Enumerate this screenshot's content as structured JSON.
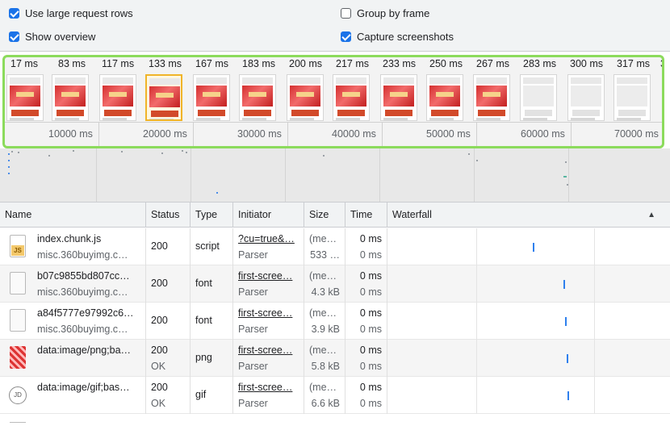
{
  "settings": {
    "use_large_rows": {
      "label": "Use large request rows",
      "checked": true
    },
    "show_overview": {
      "label": "Show overview",
      "checked": true
    },
    "group_by_frame": {
      "label": "Group by frame",
      "checked": false
    },
    "capture_screenshots": {
      "label": "Capture screenshots",
      "checked": true
    }
  },
  "overview": {
    "frame_times": [
      "17 ms",
      "83 ms",
      "117 ms",
      "133 ms",
      "167 ms",
      "183 ms",
      "200 ms",
      "217 ms",
      "233 ms",
      "250 ms",
      "267 ms",
      "283 ms",
      "300 ms",
      "317 ms",
      "3"
    ],
    "selected_frame_index": 3,
    "blank_frame_indices": [
      11,
      12,
      13
    ],
    "tick_labels": [
      "10000 ms",
      "20000 ms",
      "30000 ms",
      "40000 ms",
      "50000 ms",
      "60000 ms",
      "70000 ms"
    ],
    "highlight_color": "#8cdb5c"
  },
  "table": {
    "columns": {
      "name": "Name",
      "status": "Status",
      "type": "Type",
      "initiator": "Initiator",
      "size": "Size",
      "time": "Time",
      "waterfall": "Waterfall"
    },
    "sort_indicator": "▲",
    "rows": [
      {
        "icon": "js-file-icon",
        "name": "index.chunk.js",
        "domain": "misc.360buyimg.c…",
        "status": "200",
        "status_text": "",
        "type": "script",
        "initiator": "?cu=true&…",
        "initiator_sub": "Parser",
        "size": "(me…",
        "size_sub": "533 …",
        "time": "0 ms",
        "time_sub": "0 ms"
      },
      {
        "icon": "blank-file-icon",
        "name": "b07c9855bd807cc…",
        "domain": "misc.360buyimg.c…",
        "status": "200",
        "status_text": "",
        "type": "font",
        "initiator": "first-scree…",
        "initiator_sub": "Parser",
        "size": "(me…",
        "size_sub": "4.3 kB",
        "time": "0 ms",
        "time_sub": "0 ms"
      },
      {
        "icon": "blank-file-icon",
        "name": "a84f5777e97992c6…",
        "domain": "misc.360buyimg.c…",
        "status": "200",
        "status_text": "",
        "type": "font",
        "initiator": "first-scree…",
        "initiator_sub": "Parser",
        "size": "(me…",
        "size_sub": "3.9 kB",
        "time": "0 ms",
        "time_sub": "0 ms"
      },
      {
        "icon": "png-image-icon",
        "name": "data:image/png;ba…",
        "domain": "",
        "status": "200",
        "status_text": "OK",
        "type": "png",
        "initiator": "first-scree…",
        "initiator_sub": "Parser",
        "size": "(me…",
        "size_sub": "5.8 kB",
        "time": "0 ms",
        "time_sub": "0 ms"
      },
      {
        "icon": "gif-image-icon",
        "name": "data:image/gif;bas…",
        "domain": "",
        "status": "200",
        "status_text": "OK",
        "type": "gif",
        "initiator": "first-scree…",
        "initiator_sub": "Parser",
        "size": "(me…",
        "size_sub": "6.6 kB",
        "time": "0 ms",
        "time_sub": "0 ms"
      }
    ],
    "gif_icon_text": "JD",
    "js_icon_text": "JS",
    "waterfall_bar_color": "#2f80ed"
  }
}
